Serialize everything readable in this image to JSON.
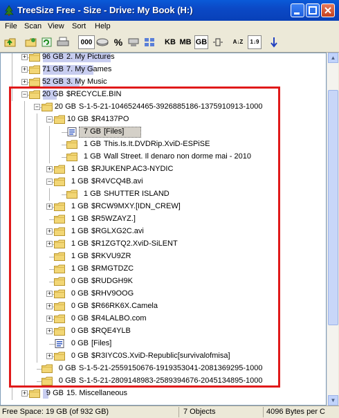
{
  "window": {
    "title": "TreeSize Free - Size - Drive: My Book (H:)"
  },
  "menu": [
    "File",
    "Scan",
    "View",
    "Sort",
    "Help"
  ],
  "toolbar": {
    "count_label": "000",
    "percent_label": "%",
    "kb": "KB",
    "mb": "MB",
    "gb": "GB",
    "sort_az": "A↓Z",
    "sort_19": "1↓9"
  },
  "tree": [
    {
      "level": 1,
      "expander": "+",
      "icon": "folder",
      "size": "96 GB",
      "name": "2. My Pictures",
      "bar": 0.35
    },
    {
      "level": 1,
      "expander": "+",
      "icon": "folder",
      "size": "71 GB",
      "name": "7. My Games",
      "bar": 0.26
    },
    {
      "level": 1,
      "expander": "+",
      "icon": "folder",
      "size": "52 GB",
      "name": "3. My Music",
      "bar": 0.19
    },
    {
      "level": 1,
      "expander": "-",
      "icon": "folder",
      "size": "20 GB",
      "name": "$RECYCLE.BIN",
      "bar": 0.07
    },
    {
      "level": 2,
      "expander": "-",
      "icon": "folder",
      "size": "20 GB",
      "name": "S-1-5-21-1046524465-3926885186-1375910913-1000",
      "bar": 0.0
    },
    {
      "level": 3,
      "expander": "-",
      "icon": "folder",
      "size": "10 GB",
      "name": "$R4137PO",
      "bar": 0.0
    },
    {
      "level": 4,
      "expander": "",
      "icon": "files",
      "size": "7 GB",
      "name": "[Files]",
      "bar": 0.0,
      "selected": true
    },
    {
      "level": 4,
      "expander": "",
      "icon": "folder",
      "size": "1 GB",
      "name": "This.Is.It.DVDRip.XviD-ESPiSE",
      "bar": 0.0
    },
    {
      "level": 4,
      "expander": "",
      "icon": "folder",
      "size": "1 GB",
      "name": "Wall Street. Il denaro non dorme mai - 2010",
      "bar": 0.0
    },
    {
      "level": 3,
      "expander": "+",
      "icon": "folder",
      "size": "1 GB",
      "name": "$RJUKENP.AC3-NYDIC",
      "bar": 0.0
    },
    {
      "level": 3,
      "expander": "-",
      "icon": "folder",
      "size": "1 GB",
      "name": "$R4VCQ4B.avi",
      "bar": 0.0
    },
    {
      "level": 4,
      "expander": "",
      "icon": "folder",
      "size": "1 GB",
      "name": "SHUTTER ISLAND",
      "bar": 0.0
    },
    {
      "level": 3,
      "expander": "+",
      "icon": "folder",
      "size": "1 GB",
      "name": "$RCW9MXY.[IDN_CREW]",
      "bar": 0.0
    },
    {
      "level": 3,
      "expander": "",
      "icon": "folder",
      "size": "1 GB",
      "name": "$R5WZAYZ.]",
      "bar": 0.0
    },
    {
      "level": 3,
      "expander": "+",
      "icon": "folder",
      "size": "1 GB",
      "name": "$RGLXG2C.avi",
      "bar": 0.0
    },
    {
      "level": 3,
      "expander": "+",
      "icon": "folder",
      "size": "1 GB",
      "name": "$R1ZGTQ2.XviD-SiLENT",
      "bar": 0.0
    },
    {
      "level": 3,
      "expander": "",
      "icon": "folder",
      "size": "1 GB",
      "name": "$RKVU9ZR",
      "bar": 0.0
    },
    {
      "level": 3,
      "expander": "",
      "icon": "folder",
      "size": "1 GB",
      "name": "$RMGTDZC",
      "bar": 0.0
    },
    {
      "level": 3,
      "expander": "",
      "icon": "folder",
      "size": "0 GB",
      "name": "$RUDGH9K",
      "bar": 0.0
    },
    {
      "level": 3,
      "expander": "+",
      "icon": "folder",
      "size": "0 GB",
      "name": "$RHV9OOG",
      "bar": 0.0
    },
    {
      "level": 3,
      "expander": "+",
      "icon": "folder",
      "size": "0 GB",
      "name": "$R66RK6X.Camela",
      "bar": 0.0
    },
    {
      "level": 3,
      "expander": "+",
      "icon": "folder",
      "size": "0 GB",
      "name": "$R4LALBO.com",
      "bar": 0.0
    },
    {
      "level": 3,
      "expander": "+",
      "icon": "folder",
      "size": "0 GB",
      "name": "$RQE4YLB",
      "bar": 0.0
    },
    {
      "level": 3,
      "expander": "",
      "icon": "files",
      "size": "0 GB",
      "name": "[Files]",
      "bar": 0.0
    },
    {
      "level": 3,
      "expander": "+",
      "icon": "folder",
      "size": "0 GB",
      "name": "$R3IYC0S.XviD-Republic[survivalofmisa]",
      "bar": 0.0
    },
    {
      "level": 2,
      "expander": "",
      "icon": "folder",
      "size": "0 GB",
      "name": "S-1-5-21-2559150676-1919353041-2081369295-1000",
      "bar": 0.0
    },
    {
      "level": 2,
      "expander": "",
      "icon": "folder",
      "size": "0 GB",
      "name": "S-1-5-21-2809148983-2589394676-2045134895-1000",
      "bar": 0.0
    },
    {
      "level": 1,
      "expander": "+",
      "icon": "folder",
      "size": "9 GB",
      "name": "15. Miscellaneous",
      "bar": 0.03
    }
  ],
  "status": {
    "free_space": "Free Space: 19 GB  (of 932 GB)",
    "objects": "7  Objects",
    "bytes": "4096 Bytes per C"
  },
  "colors": {
    "bar": "#c8cdf0",
    "highlight": "#e0191a",
    "folder": "#f2d675"
  }
}
